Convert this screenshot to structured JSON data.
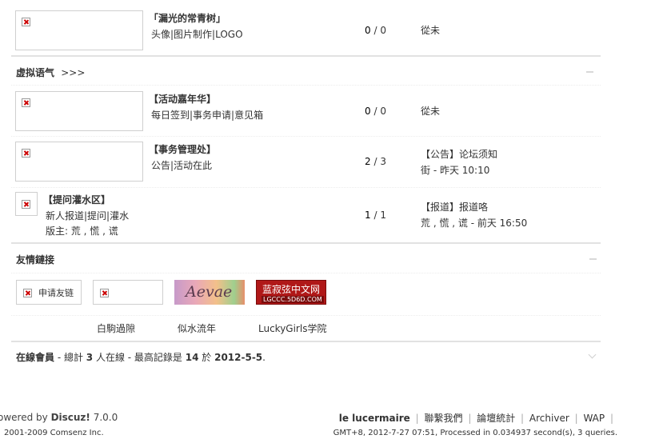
{
  "forums": [
    {
      "name": "「漏光的常青树」",
      "subs": "头像|图片制作|LOGO",
      "counts_a": "0",
      "counts_sep": " / ",
      "counts_b": "0",
      "last_line1": "從未",
      "last_line2": ""
    }
  ],
  "category_virtual": {
    "title": "虚拟语气",
    "arrows": ">>>"
  },
  "virtual_forums": [
    {
      "name": "【活动嘉年华】",
      "subs": "每日签到|事务申请|意见箱",
      "counts_a": "0",
      "counts_b": "0",
      "last_line1": "從未",
      "last_line2": ""
    },
    {
      "name": "【事务管理处】",
      "subs": "公告|活动在此",
      "counts_a": "2",
      "counts_b": "3",
      "last_line1": "【公告】论坛须知",
      "last_line2": "街 - 昨天 10:10"
    },
    {
      "name": "【提问灌水区】",
      "subs": "新人报道|提问|灌水",
      "moderators": "版主: 荒 , 慌 , 谎",
      "counts_a": "1",
      "counts_b": "1",
      "last_line1": "【报道】报道咯",
      "last_line2": "荒 , 慌 , 谎 - 前天 16:50"
    }
  ],
  "links_section": {
    "title": "友情鏈接",
    "apply_label": "申请友链",
    "banner_aevae": "Aevae",
    "banner_lgccc_top": "蓝寂弦中文网",
    "banner_lgccc_bottom": "LGCCC.5D6D.COM",
    "text_links": [
      "白駒過隙",
      "似水流年",
      "LuckyGirls学院"
    ]
  },
  "online": {
    "label": "在線會員",
    "prefix": " - 總計 ",
    "count": "3",
    "mid": " 人在線  - 最高記錄是 ",
    "record": "14",
    "on": " 於 ",
    "date": "2012-5-5",
    "suffix": "."
  },
  "footer": {
    "powered_prefix": "owered by ",
    "powered_brand": "Discuz!",
    "powered_version": " 7.0.0",
    "copyright": "2001-2009 Comsenz Inc.",
    "site_name": "le lucermaire",
    "nav": [
      "聯繫我們",
      "論壇統計",
      "Archiver",
      "WAP"
    ],
    "status": "GMT+8, 2012-7-27 07:51, Processed in 0.034937 second(s), 3 queries."
  },
  "colors": {
    "banner_red": "#b01818",
    "text": "#333333"
  }
}
